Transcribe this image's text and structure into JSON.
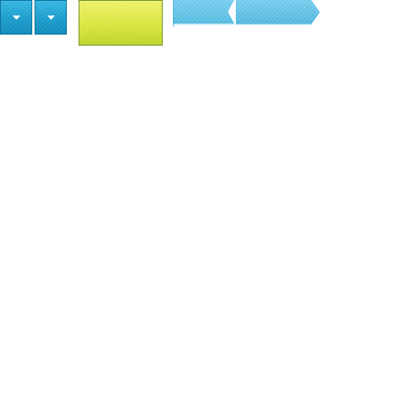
{
  "dropdown_buttons": [
    {
      "icon": "caret-down-icon"
    },
    {
      "icon": "caret-down-icon"
    }
  ],
  "swatch": {
    "color_top": "#eef06a",
    "color_bottom": "#bcd42a",
    "border": "#6a8f2a"
  },
  "ribbons": [
    {
      "color": "#5cc3ea",
      "shape": "notched-left-ribbon"
    },
    {
      "color": "#5cc3ea",
      "shape": "arrow-right-tag"
    }
  ],
  "colors": {
    "button_blue": "#1a9ccc",
    "button_border": "#0b6f95",
    "ribbon_blue": "#5cc3ea"
  }
}
